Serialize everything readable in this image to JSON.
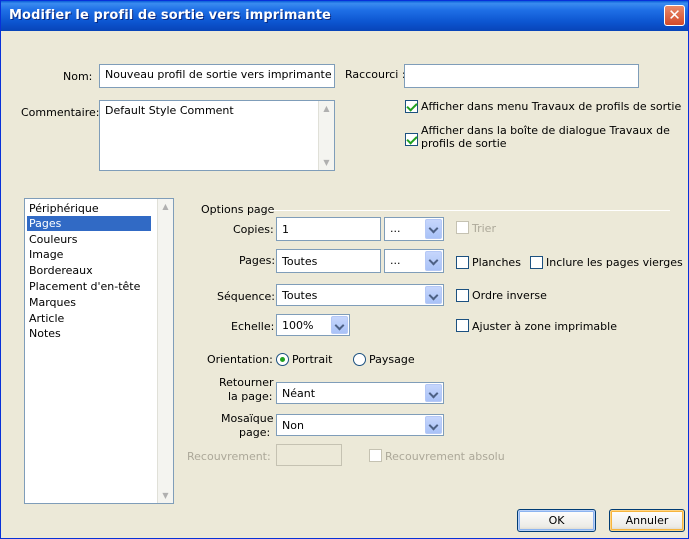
{
  "window": {
    "title": "Modifier le profil de sortie vers imprimante"
  },
  "form": {
    "nom_label": "Nom:",
    "nom_value": "Nouveau profil de sortie vers imprimante",
    "raccourci_label": "Raccourci :",
    "raccourci_value": "",
    "commentaire_label": "Commentaire:",
    "commentaire_value": "Default Style Comment",
    "show_in_menu_label": "Afficher dans menu Travaux de profils de sortie",
    "show_in_menu_checked": true,
    "show_in_dialog_label": "Afficher dans la boîte de dialogue Travaux de profils de sortie",
    "show_in_dialog_checked": true
  },
  "categories": {
    "items": [
      "Périphérique",
      "Pages",
      "Couleurs",
      "Image",
      "Bordereaux",
      "Placement d'en-tête",
      "Marques",
      "Article",
      "Notes"
    ],
    "selected": "Pages"
  },
  "pages": {
    "group_title": "Options page",
    "copies_label": "Copies:",
    "copies_value": "1",
    "copies_combo": "...",
    "trier_label": "Trier",
    "pages_label": "Pages:",
    "pages_value": "Toutes",
    "pages_combo": "...",
    "planches_label": "Planches",
    "inclure_label": "Inclure les pages vierges",
    "sequence_label": "Séquence:",
    "sequence_value": "Toutes",
    "ordre_label": "Ordre inverse",
    "echelle_label": "Echelle:",
    "echelle_value": "100%",
    "ajuster_label": "Ajuster à zone imprimable",
    "orientation_label": "Orientation:",
    "portrait_label": "Portrait",
    "paysage_label": "Paysage",
    "orientation_selected": "Portrait",
    "retourner_label_1": "Retourner",
    "retourner_label_2": "la page:",
    "retourner_value": "Néant",
    "mosaique_label_1": "Mosaïque",
    "mosaique_label_2": "page:",
    "mosaique_value": "Non",
    "recouvrement_label": "Recouvrement:",
    "recouvrement_value": "",
    "recouvrement_absolu_label": "Recouvrement absolu"
  },
  "buttons": {
    "ok": "OK",
    "annuler": "Annuler"
  },
  "colors": {
    "title_bar": "#0c55d0",
    "selection": "#316ac5",
    "dialog_bg": "#ece9d8"
  }
}
